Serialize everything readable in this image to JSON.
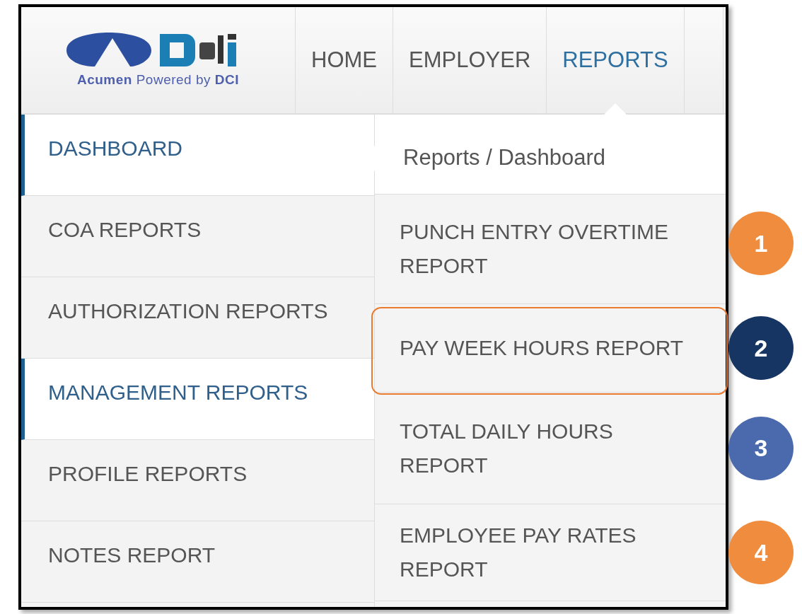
{
  "logo": {
    "tagline": "**Acumen** Powered by **DCI**"
  },
  "nav": [
    {
      "label": "HOME",
      "selected": false
    },
    {
      "label": "EMPLOYER",
      "selected": false
    },
    {
      "label": "REPORTS",
      "selected": true
    }
  ],
  "sidebar": {
    "items": [
      {
        "label": "DASHBOARD",
        "selected": true
      },
      {
        "label": "COA REPORTS",
        "selected": false
      },
      {
        "label": "AUTHORIZATION REPORTS",
        "selected": false
      },
      {
        "label": "MANAGEMENT REPORTS",
        "selected": true
      },
      {
        "label": "PROFILE REPORTS",
        "selected": false
      },
      {
        "label": "NOTES REPORT",
        "selected": false
      }
    ]
  },
  "submenu": {
    "breadcrumb": "Reports / Dashboard",
    "items": [
      {
        "label": "PUNCH ENTRY OVERTIME REPORT",
        "highlighted": false,
        "badge": {
          "label": "1",
          "color": "#ef8c3e"
        }
      },
      {
        "label": "PAY WEEK HOURS REPORT",
        "highlighted": true,
        "badge": {
          "label": "2",
          "color": "#173563"
        }
      },
      {
        "label": "TOTAL DAILY HOURS REPORT",
        "highlighted": false,
        "badge": {
          "label": "3",
          "color": "#4a6aad"
        }
      },
      {
        "label": "EMPLOYEE PAY RATES REPORT",
        "highlighted": false,
        "badge": {
          "label": "4",
          "color": "#ef8c3e"
        }
      }
    ]
  }
}
